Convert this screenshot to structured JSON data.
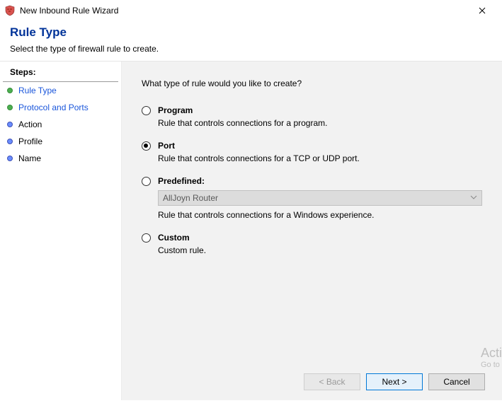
{
  "window": {
    "title": "New Inbound Rule Wizard"
  },
  "header": {
    "title": "Rule Type",
    "subtitle": "Select the type of firewall rule to create."
  },
  "sidebar": {
    "title": "Steps:",
    "items": [
      {
        "label": "Rule Type",
        "state": "current"
      },
      {
        "label": "Protocol and Ports",
        "state": "link"
      },
      {
        "label": "Action",
        "state": "future"
      },
      {
        "label": "Profile",
        "state": "future"
      },
      {
        "label": "Name",
        "state": "future"
      }
    ]
  },
  "main": {
    "prompt": "What type of rule would you like to create?",
    "options": [
      {
        "key": "program",
        "title": "Program",
        "desc": "Rule that controls connections for a program.",
        "selected": false
      },
      {
        "key": "port",
        "title": "Port",
        "desc": "Rule that controls connections for a TCP or UDP port.",
        "selected": true
      },
      {
        "key": "predefined",
        "title": "Predefined:",
        "desc": "Rule that controls connections for a Windows experience.",
        "selected": false,
        "dropdown": "AllJoyn Router"
      },
      {
        "key": "custom",
        "title": "Custom",
        "desc": "Custom rule.",
        "selected": false
      }
    ]
  },
  "buttons": {
    "back": "< Back",
    "next": "Next >",
    "cancel": "Cancel"
  },
  "watermark": {
    "line1": "Activate Windows",
    "line2": "Go to Settings to activate Windows."
  }
}
